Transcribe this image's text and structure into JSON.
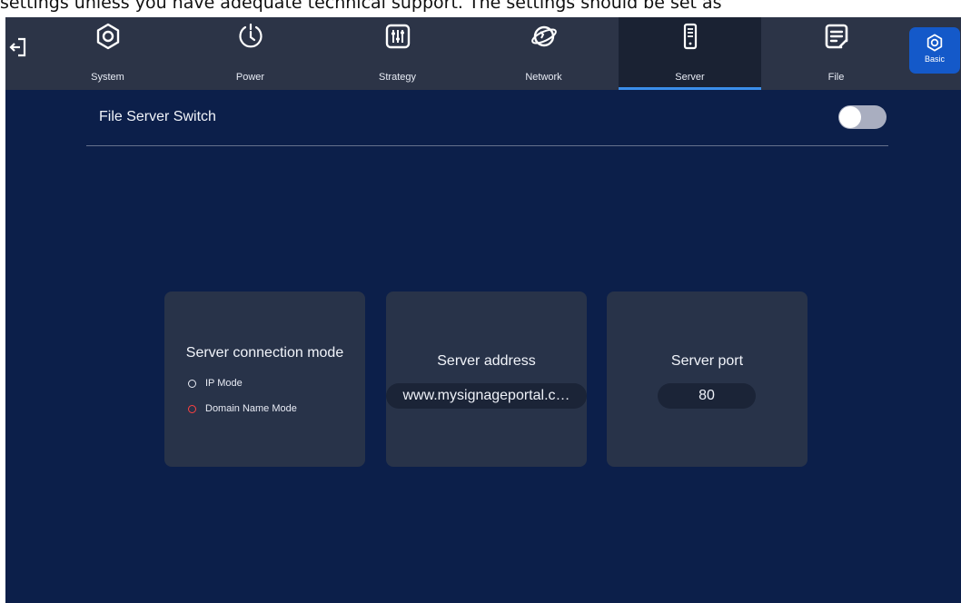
{
  "doc_text": "settings unless you have adequate technical support. The settings should be set as",
  "tabs": [
    {
      "label": "System",
      "icon": "gear-icon"
    },
    {
      "label": "Power",
      "icon": "power-clock-icon"
    },
    {
      "label": "Strategy",
      "icon": "sliders-icon"
    },
    {
      "label": "Network",
      "icon": "globe-icon"
    },
    {
      "label": "Server",
      "icon": "server-icon",
      "active": true
    },
    {
      "label": "File",
      "icon": "file-icon"
    }
  ],
  "basic_button": {
    "label": "Basic",
    "icon": "gear-icon"
  },
  "file_server": {
    "label": "File Server Switch",
    "enabled": false
  },
  "cards": {
    "connection_mode": {
      "title": "Server connection mode",
      "options": [
        {
          "label": "IP Mode",
          "selected": false
        },
        {
          "label": "Domain Name Mode",
          "selected": true
        }
      ]
    },
    "address": {
      "title": "Server address",
      "value": "www.mysignageportal.c…"
    },
    "port": {
      "title": "Server port",
      "value": "80"
    }
  },
  "colors": {
    "background": "#0c1f4a",
    "topbar": "#2c3447",
    "card": "#283349",
    "accent": "#1459c9",
    "selected_radio": "#ff4040"
  }
}
